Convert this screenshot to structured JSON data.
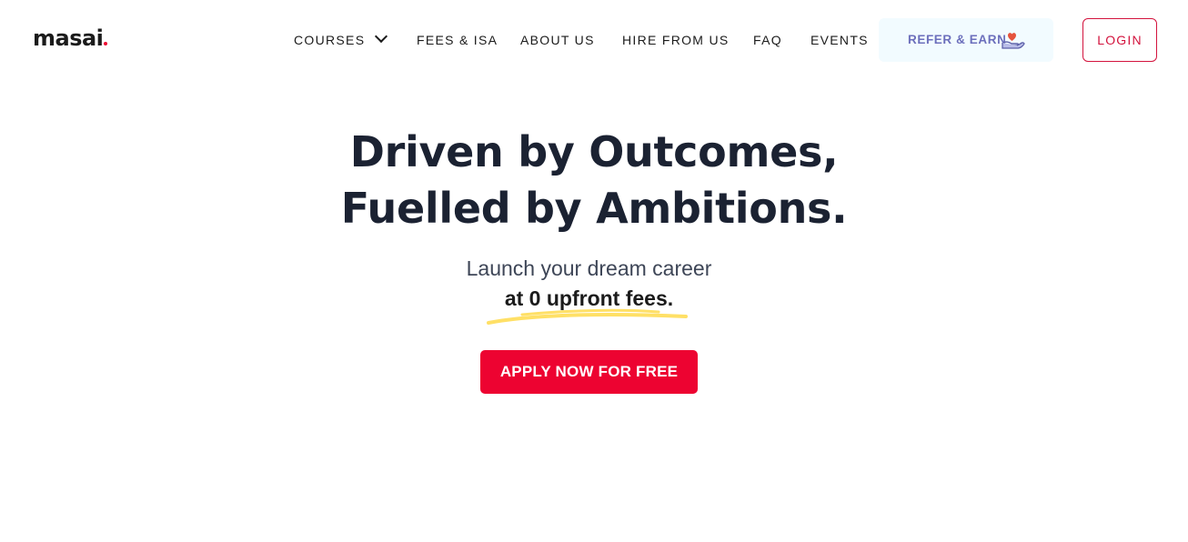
{
  "brand": {
    "name": "masai",
    "accent_color": "#ED0331"
  },
  "nav": {
    "courses": {
      "label": "COURSES",
      "icon": "chevron-down-icon"
    },
    "fees": "FEES & ISA",
    "about": "ABOUT US",
    "hire": "HIRE FROM US",
    "faq": "FAQ",
    "events": "EVENTS"
  },
  "refer": {
    "label": "REFER & EARN",
    "icon": "heart-hand-icon"
  },
  "login": {
    "label": "LOGIN"
  },
  "hero": {
    "line1": "Driven by Outcomes,",
    "line2": "Fuelled by Ambitions.",
    "sub1": "Launch your dream career",
    "sub2": "at 0 upfront fees.",
    "cta": "APPLY NOW FOR FREE"
  },
  "colors": {
    "heading": "#1B2232",
    "cta": "#ED0331",
    "login_border": "#D3133D",
    "refer_bg": "#F2FBFF",
    "refer_text": "#6C6FBC",
    "highlight": "#FFE066"
  }
}
